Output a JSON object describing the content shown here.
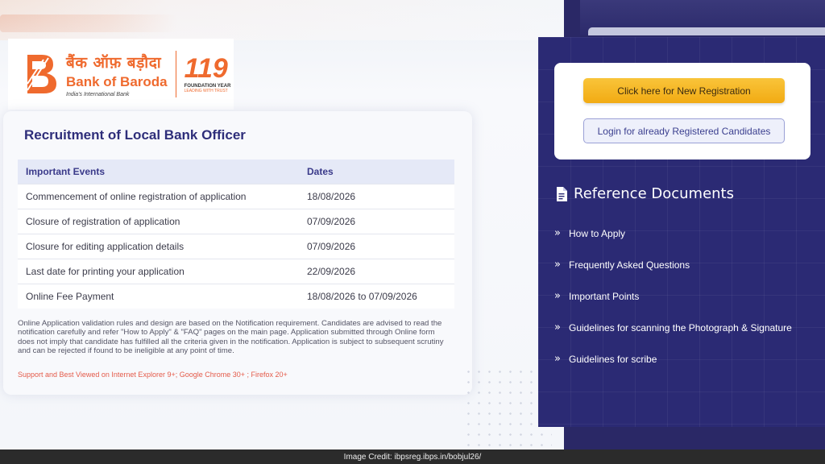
{
  "logo": {
    "hindi": "बैंक ऑफ़ बड़ौदा",
    "english": "Bank of Baroda",
    "tagline": "India's International Bank",
    "anniversary_number": "119",
    "anniversary_label": "FOUNDATION YEAR",
    "anniversary_tagline": "LEADING WITH TRUST",
    "brand_color": "#ef6a2e"
  },
  "main": {
    "title": "Recruitment of Local Bank Officer",
    "table": {
      "headers": [
        "Important Events",
        "Dates"
      ],
      "rows": [
        [
          "Commencement of online registration of application",
          "18/08/2026"
        ],
        [
          "Closure of registration of application",
          "07/09/2026"
        ],
        [
          "Closure for editing application details",
          "07/09/2026"
        ],
        [
          "Last date for printing your application",
          "22/09/2026"
        ],
        [
          "Online Fee Payment",
          "18/08/2026 to 07/09/2026"
        ]
      ]
    },
    "notice": "Online Application validation rules and design are based on the Notification requirement. Candidates are advised to read the notification carefully and refer \"How to Apply\" & \"FAQ\" pages on the main page. Application submitted through Online form does not imply that candidate has fulfilled all the criteria given in the notification. Application is subject to subsequent scrutiny and can be rejected if found to be ineligible at any point of time.",
    "support": "Support and Best Viewed on Internet Explorer 9+; Google Chrome 30+ ; Firefox 20+"
  },
  "registration": {
    "new_label": "Click here for New Registration",
    "login_label": "Login for already Registered Candidates"
  },
  "reference": {
    "icon": "document-icon",
    "title": "Reference Documents",
    "items": [
      {
        "label": "How to Apply",
        "icon": "chevron-right-icon"
      },
      {
        "label": "Frequently Asked Questions",
        "icon": "chevron-right-icon"
      },
      {
        "label": "Important Points",
        "icon": "chevron-right-icon"
      },
      {
        "label": "Guidelines for scanning the Photograph & Signature",
        "icon": "chevron-right-icon"
      },
      {
        "label": "Guidelines for scribe",
        "icon": "chevron-right-icon"
      }
    ]
  },
  "credit": "Image Credit: ibpsreg.ibps.in/bobjul26/",
  "colors": {
    "panel": "#2b2a74",
    "title": "#2e2e7a",
    "button_primary": "#f2ab13",
    "support_text": "#e45b4a"
  }
}
